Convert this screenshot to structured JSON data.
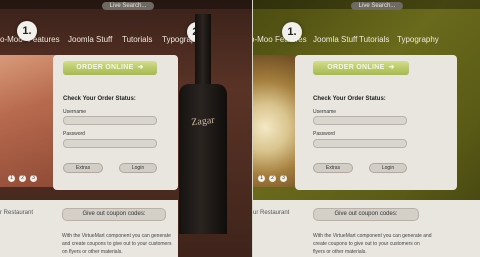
{
  "left": {
    "search_text": "Live Search...",
    "nav": [
      "o-Moo",
      "Features",
      "Joomla Stuff",
      "Tutorials",
      "Typography"
    ],
    "badges": [
      "1.",
      "2."
    ],
    "bottle_label": "Zagar",
    "order_button": "ORDER ONLINE",
    "order_status_title": "Check Your Order Status:",
    "username_label": "Username",
    "password_label": "Password",
    "extras_button": "Extras",
    "login_button": "Login",
    "slider_dots": [
      "1",
      "2",
      "3"
    ],
    "restaurant_text": "r Restaurant",
    "coupon_label": "Give out coupon codes:",
    "coupon_text": "With the VirtueMart component you can generate and create coupons to give out to your customers on flyers or other materials."
  },
  "right": {
    "search_text": "Live Search...",
    "nav": [
      "o-Moo",
      "Features",
      "Joomla Stuff",
      "Tutorials",
      "Typography"
    ],
    "badges": [
      "1."
    ],
    "order_button": "ORDER ONLINE",
    "order_status_title": "Check Your Order Status:",
    "username_label": "Username",
    "password_label": "Password",
    "extras_button": "Extras",
    "login_button": "Login",
    "slider_dots": [
      "1",
      "2",
      "3"
    ],
    "restaurant_text": "ur Restaurant",
    "coupon_label": "Give out coupon codes:",
    "coupon_text": "With the VirtueMart component you can generate and create coupons to give out to your customers on flyers or other materials."
  },
  "colors": {
    "left_bg": "#5a3326",
    "right_bg": "#6a6a1c",
    "order_button": "#b9c865",
    "card_bg": "#e9e6e0"
  },
  "icons": {
    "order_arrow": "arrow-right-icon",
    "bottle": "wine-bottle-image"
  }
}
